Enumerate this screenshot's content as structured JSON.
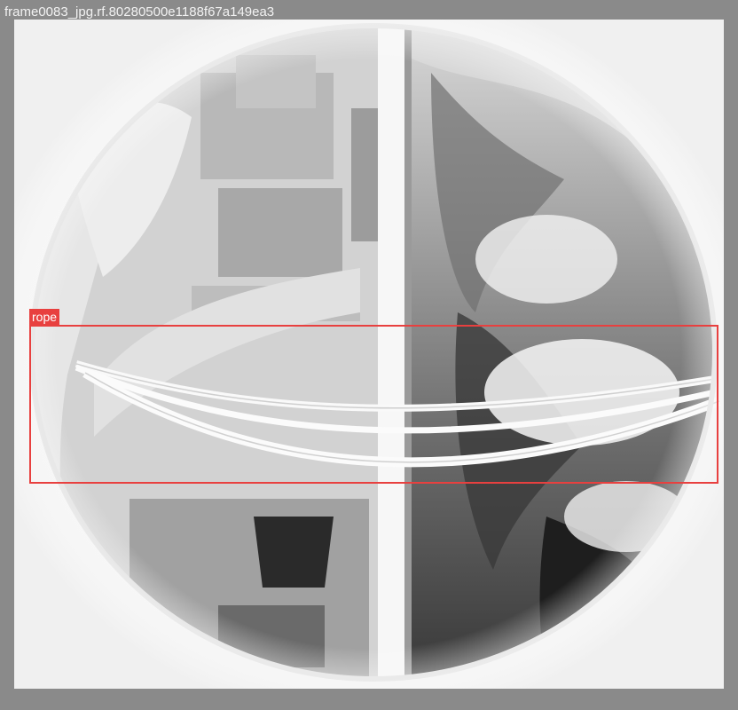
{
  "image": {
    "filename": "frame0083_jpg.rf.80280500e1188f67a149ea3",
    "description": "Grayscale inverted fisheye aerial view from a tower looking down at cables (ropes), city buildings on the left and cloud/terrain on the right"
  },
  "annotations": [
    {
      "label": "rope",
      "color": "#e8403f"
    }
  ],
  "colors": {
    "background": "#8a8a8a",
    "box": "#e8403f"
  }
}
